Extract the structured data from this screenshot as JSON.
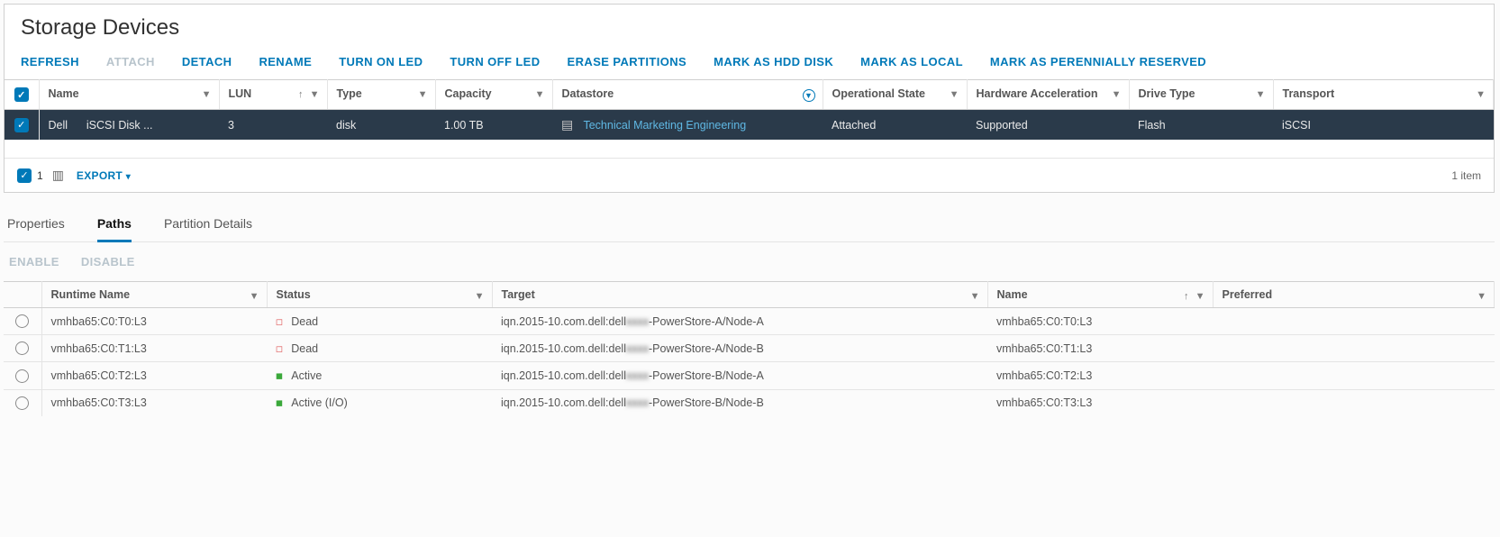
{
  "title": "Storage Devices",
  "toolbar": {
    "refresh": "REFRESH",
    "attach": "ATTACH",
    "detach": "DETACH",
    "rename": "RENAME",
    "turn_on_led": "TURN ON LED",
    "turn_off_led": "TURN OFF LED",
    "erase_partitions": "ERASE PARTITIONS",
    "mark_hdd": "MARK AS HDD DISK",
    "mark_local": "MARK AS LOCAL",
    "mark_perennial": "MARK AS PERENNIALLY RESERVED"
  },
  "columns": {
    "name": "Name",
    "lun": "LUN",
    "type": "Type",
    "capacity": "Capacity",
    "datastore": "Datastore",
    "op_state": "Operational State",
    "hw_accel": "Hardware Acceleration",
    "drive_type": "Drive Type",
    "transport": "Transport"
  },
  "devices": [
    {
      "name_vendor": "Dell",
      "name_model": "iSCSI Disk ...",
      "lun": "3",
      "type": "disk",
      "capacity": "1.00 TB",
      "datastore": "Technical Marketing Engineering",
      "op_state": "Attached",
      "hw_accel": "Supported",
      "drive_type": "Flash",
      "transport": "iSCSI"
    }
  ],
  "footer": {
    "selected": "1",
    "export": "EXPORT",
    "item_count": "1 item"
  },
  "tabs": {
    "properties": "Properties",
    "paths": "Paths",
    "partition": "Partition Details"
  },
  "path_actions": {
    "enable": "ENABLE",
    "disable": "DISABLE"
  },
  "path_columns": {
    "runtime": "Runtime Name",
    "status": "Status",
    "target": "Target",
    "name": "Name",
    "preferred": "Preferred"
  },
  "target_prefix": "iqn.2015-10.com.dell:dell",
  "target_redacted": "xxxx",
  "paths": [
    {
      "runtime": "vmhba65:C0:T0:L3",
      "status": "Dead",
      "suffix": "-PowerStore-A/Node-A",
      "name": "vmhba65:C0:T0:L3",
      "preferred": ""
    },
    {
      "runtime": "vmhba65:C0:T1:L3",
      "status": "Dead",
      "suffix": "-PowerStore-A/Node-B",
      "name": "vmhba65:C0:T1:L3",
      "preferred": ""
    },
    {
      "runtime": "vmhba65:C0:T2:L3",
      "status": "Active",
      "suffix": "-PowerStore-B/Node-A",
      "name": "vmhba65:C0:T2:L3",
      "preferred": ""
    },
    {
      "runtime": "vmhba65:C0:T3:L3",
      "status": "Active (I/O)",
      "suffix": "-PowerStore-B/Node-B",
      "name": "vmhba65:C0:T3:L3",
      "preferred": ""
    }
  ]
}
